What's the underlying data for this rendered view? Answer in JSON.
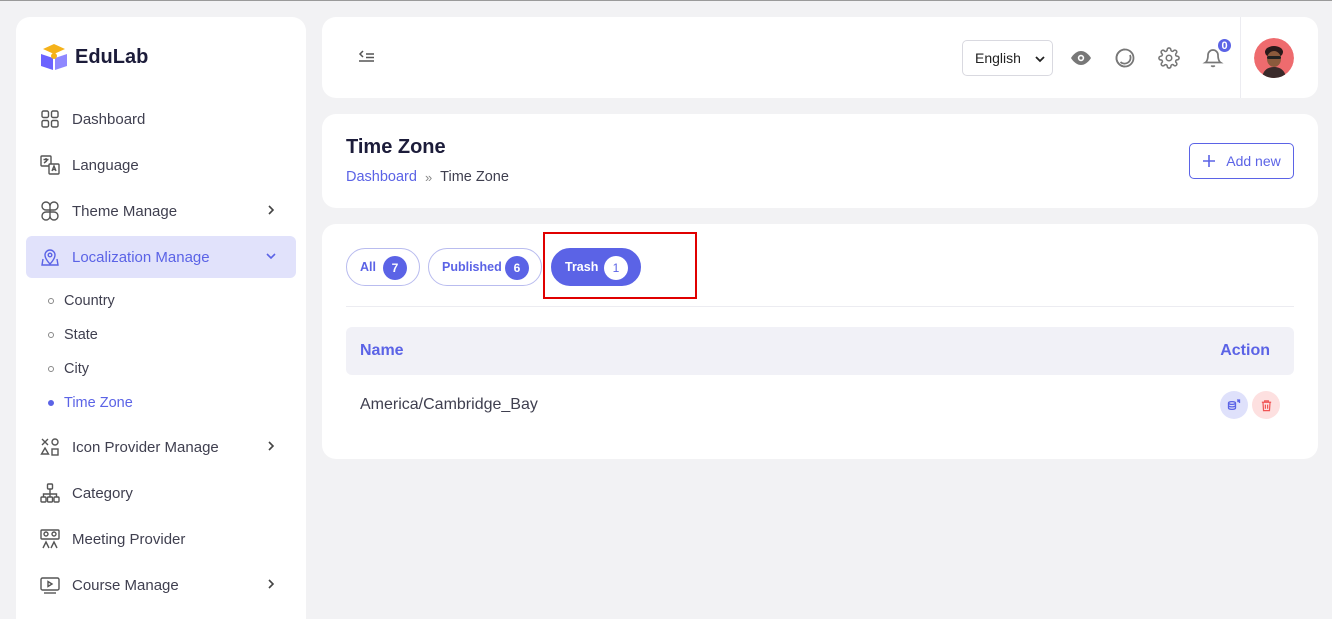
{
  "brand": {
    "name": "EduLab"
  },
  "sidebar": {
    "items": [
      {
        "label": "Dashboard",
        "icon": "grid-icon"
      },
      {
        "label": "Language",
        "icon": "translate-icon"
      },
      {
        "label": "Theme Manage",
        "icon": "flower-icon"
      },
      {
        "label": "Localization Manage",
        "icon": "map-pin-icon"
      },
      {
        "label": "Icon Provider Manage",
        "icon": "shapes-icon"
      },
      {
        "label": "Category",
        "icon": "hierarchy-icon"
      },
      {
        "label": "Meeting Provider",
        "icon": "people-icon"
      },
      {
        "label": "Course Manage",
        "icon": "video-icon"
      }
    ],
    "submenu": [
      {
        "label": "Country"
      },
      {
        "label": "State"
      },
      {
        "label": "City"
      },
      {
        "label": "Time Zone"
      }
    ]
  },
  "topbar": {
    "language": "English",
    "notification_count": "0"
  },
  "page": {
    "title": "Time Zone",
    "breadcrumb": {
      "home": "Dashboard",
      "current": "Time Zone"
    },
    "add_label": "Add new"
  },
  "tabs": [
    {
      "label": "All",
      "count": "7"
    },
    {
      "label": "Published",
      "count": "6"
    },
    {
      "label": "Trash",
      "count": "1"
    }
  ],
  "table": {
    "headers": {
      "name": "Name",
      "action": "Action"
    },
    "rows": [
      {
        "name": "America/Cambridge_Bay"
      }
    ]
  },
  "colors": {
    "accent": "#5b63e6",
    "highlight": "#e00000",
    "danger": "#f05454"
  }
}
